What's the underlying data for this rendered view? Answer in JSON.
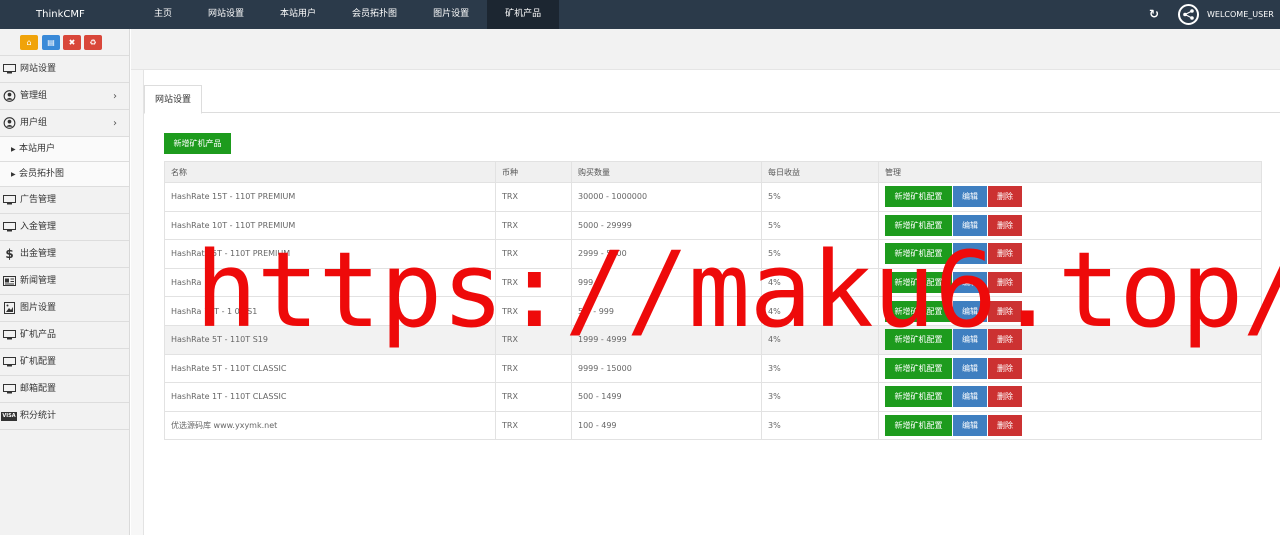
{
  "header": {
    "brand": "ThinkCMF",
    "nav": [
      "主页",
      "网站设置",
      "本站用户",
      "会员拓扑图",
      "图片设置",
      "矿机产品"
    ],
    "active_nav": "矿机产品",
    "user_name": "WELCOME_USER",
    "refresh_icon": "refresh-icon",
    "user_icon": "share-node-icon"
  },
  "shortcuts": [
    {
      "icon": "home-icon",
      "color": "#f0a30a"
    },
    {
      "icon": "document-icon",
      "color": "#3a8ad8"
    },
    {
      "icon": "trash-icon",
      "color": "#d9473a"
    },
    {
      "icon": "recycle-icon",
      "color": "#d9473a"
    }
  ],
  "sidebar": {
    "items": [
      {
        "label": "网站设置",
        "icon": "monitor-icon"
      },
      {
        "label": "管理组",
        "icon": "user-circle-icon"
      },
      {
        "label": "用户组",
        "icon": "user-circle-icon"
      },
      {
        "label": "本站用户"
      },
      {
        "label": "会员拓扑图"
      },
      {
        "label": "广告管理",
        "icon": "monitor-icon"
      },
      {
        "label": "入金管理",
        "icon": "monitor-icon"
      },
      {
        "label": "出金管理",
        "icon": "dollar-icon"
      },
      {
        "label": "新闻管理",
        "icon": "newspaper-icon"
      },
      {
        "label": "图片设置",
        "icon": "image-icon"
      },
      {
        "label": "矿机产品",
        "icon": "monitor-icon"
      },
      {
        "label": "矿机配置",
        "icon": "monitor-icon"
      },
      {
        "label": "邮箱配置",
        "icon": "monitor-icon"
      },
      {
        "label": "积分统计",
        "icon": "visa-icon"
      }
    ]
  },
  "tab_label": "网站设置",
  "add_button": "新增矿机产品",
  "table": {
    "headers": [
      "名称",
      "币种",
      "购买数量",
      "每日收益",
      "管理"
    ],
    "rows": [
      {
        "name": "HashRate 15T - 110T PREMIUM",
        "coin": "TRX",
        "qty": "30000 - 1000000",
        "daily": "5%"
      },
      {
        "name": "HashRate 10T - 110T PREMIUM",
        "coin": "TRX",
        "qty": "5000 - 29999",
        "daily": "5%"
      },
      {
        "name": "HashRate 5T - 110T PREMIUM",
        "coin": "TRX",
        "qty": "2999 - 5000",
        "daily": "5%"
      },
      {
        "name": "HashRa",
        "coin": "TRX",
        "qty": "999",
        "daily": "4%"
      },
      {
        "name": "HashRa 10T - 1 0T S1",
        "coin": "TRX",
        "qty": "5 0 - 999",
        "daily": "4%"
      },
      {
        "name": "HashRate 5T - 110T S19",
        "coin": "TRX",
        "qty": "1999 - 4999",
        "daily": "4%"
      },
      {
        "name": "HashRate 5T - 110T CLASSIC",
        "coin": "TRX",
        "qty": "9999 - 15000",
        "daily": "3%"
      },
      {
        "name": "HashRate 1T - 110T CLASSIC",
        "coin": "TRX",
        "qty": "500 - 1499",
        "daily": "3%"
      },
      {
        "name": "优选源码库 www.yxymk.net",
        "coin": "TRX",
        "qty": "100 - 499",
        "daily": "3%"
      }
    ],
    "actions": {
      "config": "新增矿机配置",
      "edit": "编辑",
      "delete": "删除"
    }
  },
  "watermark": "https://maku6.top/"
}
